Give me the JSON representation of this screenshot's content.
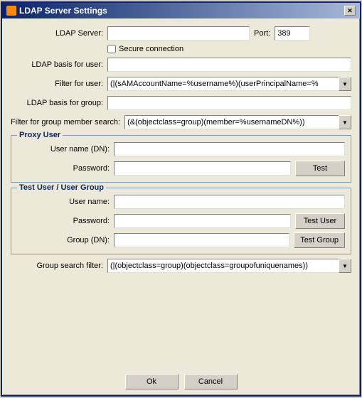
{
  "window": {
    "title": "LDAP Server Settings"
  },
  "form": {
    "ldap_server_label": "LDAP Server:",
    "ldap_server_value": "",
    "port_label": "Port:",
    "port_value": "389",
    "secure_connection_label": "Secure connection",
    "ldap_basis_user_label": "LDAP basis for user:",
    "ldap_basis_user_value": "",
    "filter_user_label": "Filter for user:",
    "filter_user_value": "(|(sAMAccountName=%username%)(userPrincipalName=%",
    "ldap_basis_group_label": "LDAP basis for group:",
    "ldap_basis_group_value": "",
    "filter_group_label": "Filter for group member search:",
    "filter_group_value": "(&(objectclass=group)(member=%usernameDN%))",
    "proxy_user_title": "Proxy User",
    "proxy_username_label": "User name (DN):",
    "proxy_username_value": "",
    "proxy_password_label": "Password:",
    "proxy_password_value": "",
    "test_button": "Test",
    "test_user_title": "Test User / User Group",
    "test_username_label": "User name:",
    "test_username_value": "",
    "test_password_label": "Password:",
    "test_password_value": "",
    "test_user_button": "Test User",
    "test_group_label": "Group (DN):",
    "test_group_value": "",
    "test_group_button": "Test Group",
    "group_search_label": "Group search filter:",
    "group_search_value": "(|(objectclass=group)(objectclass=groupofuniquenames))",
    "ok_button": "Ok",
    "cancel_button": "Cancel"
  }
}
